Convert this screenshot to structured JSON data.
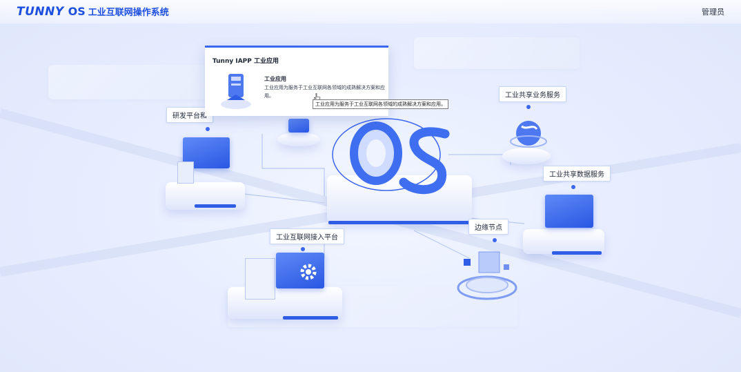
{
  "header": {
    "logo": "TUNNY",
    "os": "OS",
    "system_name": "工业互联网操作系统",
    "user": "管理员"
  },
  "popup": {
    "title": "Tunny IAPP  工业应用",
    "heading": "工业应用",
    "description": "工业应用为服务于工业互联网各领域的成熟解决方案和应用。"
  },
  "tooltip": "工业应用为服务于工业互联网各领域的成熟解决方案和应用。",
  "nodes": {
    "rd_platform": "研发平台和",
    "shared_business": "工业共享业务服务",
    "shared_data": "工业共享数据服务",
    "edge_node": "边缘节点",
    "access_platform": "工业互联网接入平台"
  },
  "center": {
    "os_text": "OS"
  },
  "colors": {
    "accent": "#1d4fe0",
    "blue": "#2f5de6",
    "bg": "#e8eeff"
  }
}
